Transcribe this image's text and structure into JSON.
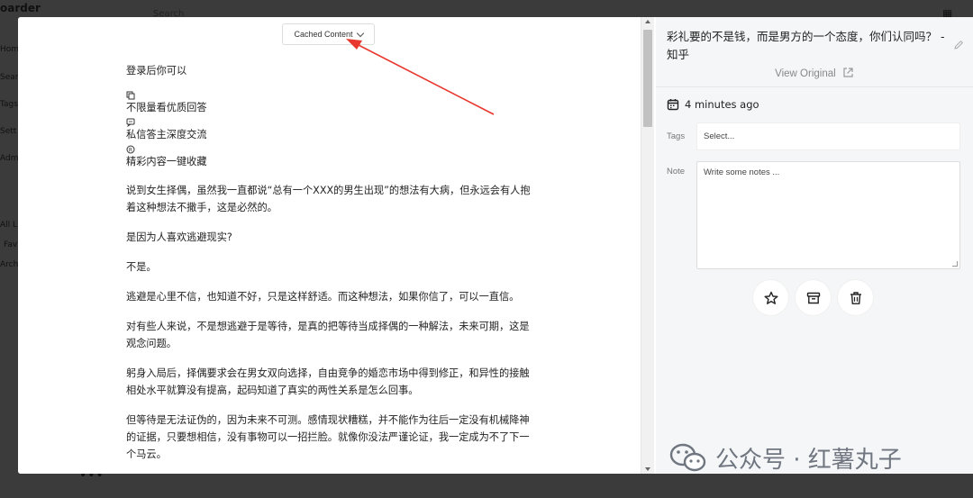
{
  "background": {
    "brand": "oarder",
    "search_placeholder": "Search",
    "nav_items": [
      "Hom",
      "Sear",
      "Tags",
      "Sett",
      "Adm",
      "All L",
      "Fav",
      "Arch"
    ],
    "more": "•••"
  },
  "reader": {
    "cached_label": "Cached Content",
    "annotation_color": "#e8372e",
    "intro": "登录后你可以",
    "features": [
      {
        "icon": "copy-icon",
        "text": "不限量看优质回答"
      },
      {
        "icon": "message-icon",
        "text": "私信答主深度交流"
      },
      {
        "icon": "register-icon",
        "text": "精彩内容一键收藏"
      }
    ],
    "paragraphs": [
      "说到女生择偶，虽然我一直都说“总有一个XXX的男生出现”的想法有大病，但永远会有人抱着这种想法不撒手，这是必然的。",
      "是因为人喜欢逃避现实?",
      "不是。",
      "逃避是心里不信，也知道不好，只是这样舒适。而这种想法，如果你信了，可以一直信。",
      "对有些人来说，不是想逃避于是等待，是真的把等待当成择偶的一种解法，未来可期，这是观念问题。",
      "躬身入局后，择偶要求会在男女双向选择，自由竞争的婚恋市场中得到修正，和异性的接触相处水平就算没有提高，起码知道了真实的两性关系是怎么回事。",
      "但等待是无法证伪的，因为未来不可测。感情现状糟糕，并不能作为往后一定没有机械降神的证据，只要想相信，没有事物可以一招拦脸。就像你没法严谨论证，我一定成为不了下一个马云。"
    ]
  },
  "sidebar": {
    "title": "彩礼要的不是钱，而是男方的一个态度，你们认同吗？ - 知乎",
    "view_original": "View Original",
    "date": "4 minutes ago",
    "tags_label": "Tags",
    "tags_placeholder": "Select...",
    "note_label": "Note",
    "note_placeholder": "Write some notes ..."
  },
  "watermark": {
    "text": "公众号 · 红薯丸子"
  }
}
